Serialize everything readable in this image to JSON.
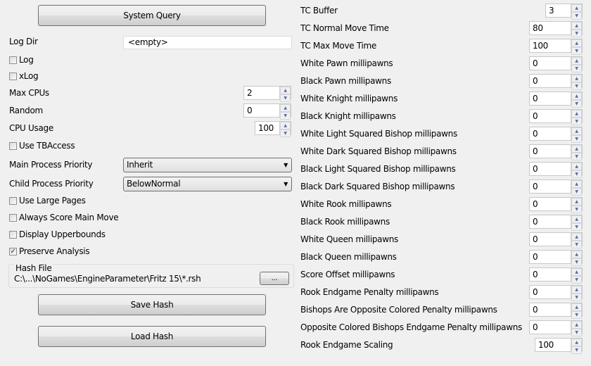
{
  "left": {
    "system_query": "System Query",
    "log_dir": {
      "label": "Log Dir",
      "value": "<empty>"
    },
    "log": {
      "label": "Log",
      "checked": false
    },
    "xlog": {
      "label": "xLog",
      "checked": false
    },
    "max_cpus": {
      "label": "Max CPUs",
      "value": "2"
    },
    "random": {
      "label": "Random",
      "value": "0"
    },
    "cpu_usage": {
      "label": "CPU Usage",
      "value": "100"
    },
    "use_tbaccess": {
      "label": "Use TBAccess",
      "checked": false
    },
    "main_priority": {
      "label": "Main Process Priority",
      "value": "Inherit"
    },
    "child_priority": {
      "label": "Child Process Priority",
      "value": "BelowNormal"
    },
    "large_pages": {
      "label": "Use Large Pages",
      "checked": false
    },
    "always_score": {
      "label": "Always Score Main Move",
      "checked": false
    },
    "upperbounds": {
      "label": "Display Upperbounds",
      "checked": false
    },
    "preserve": {
      "label": "Preserve Analysis",
      "checked": true
    },
    "hash_file": {
      "label": "Hash File",
      "path": "C:\\...\\NoGames\\EngineParameter\\Fritz 15\\*.rsh",
      "browse": "..."
    },
    "save_hash": "Save Hash",
    "load_hash": "Load Hash"
  },
  "right": [
    {
      "label": "TC Buffer",
      "value": "3"
    },
    {
      "label": "TC Normal Move Time",
      "value": "80"
    },
    {
      "label": "TC Max Move Time",
      "value": "100"
    },
    {
      "label": "White Pawn millipawns",
      "value": "0"
    },
    {
      "label": "Black Pawn millipawns",
      "value": "0"
    },
    {
      "label": "White Knight millipawns",
      "value": "0"
    },
    {
      "label": "Black Knight millipawns",
      "value": "0"
    },
    {
      "label": "White Light Squared Bishop millipawns",
      "value": "0"
    },
    {
      "label": "White Dark Squared Bishop millipawns",
      "value": "0"
    },
    {
      "label": "Black Light Squared Bishop millipawns",
      "value": "0"
    },
    {
      "label": "Black Dark Squared Bishop millipawns",
      "value": "0"
    },
    {
      "label": "White Rook millipawns",
      "value": "0"
    },
    {
      "label": "Black Rook millipawns",
      "value": "0"
    },
    {
      "label": "White Queen millipawns",
      "value": "0"
    },
    {
      "label": "Black Queen millipawns",
      "value": "0"
    },
    {
      "label": "Score Offset millipawns",
      "value": "0"
    },
    {
      "label": "Rook Endgame Penalty millipawns",
      "value": "0"
    },
    {
      "label": "Bishops Are Opposite Colored Penalty millipawns",
      "value": "0"
    },
    {
      "label": "Opposite Colored Bishops Endgame Penalty millipawns",
      "value": "0"
    },
    {
      "label": "Rook Endgame Scaling",
      "value": "100"
    }
  ]
}
